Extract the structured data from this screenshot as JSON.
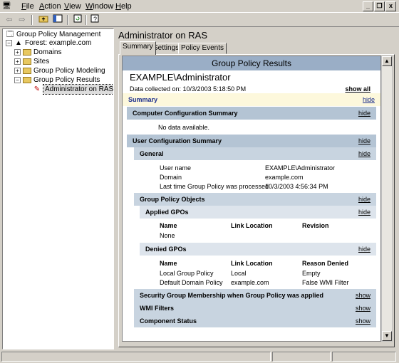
{
  "menu": {
    "file": "File",
    "action": "Action",
    "view": "View",
    "window": "Window",
    "help": "Help"
  },
  "window_controls": {
    "minimize": "_",
    "restore": "❐",
    "close": "x"
  },
  "tree": {
    "root": "Group Policy Management",
    "forest": "Forest: example.com",
    "domains": "Domains",
    "sites": "Sites",
    "modeling": "Group Policy Modeling",
    "results": "Group Policy Results",
    "admin": "Administrator on RAS"
  },
  "pane": {
    "title": "Administrator on RAS",
    "tabs": [
      "Summary",
      "Settings",
      "Policy Events"
    ]
  },
  "report": {
    "header": "Group Policy Results",
    "account": "EXAMPLE\\Administrator",
    "collected": "Data collected on: 10/3/2003 5:18:50 PM",
    "show_all": "show all",
    "hide": "hide",
    "show": "show",
    "summary": "Summary",
    "computer_summary": "Computer Configuration Summary",
    "no_data": "No data available.",
    "user_summary": "User Configuration Summary",
    "general": "General",
    "general_rows": [
      {
        "label": "User name",
        "value": "EXAMPLE\\Administrator"
      },
      {
        "label": "Domain",
        "value": "example.com"
      },
      {
        "label": "Last time Group Policy was processed",
        "value": "10/3/2003 4:56:34 PM"
      }
    ],
    "gpo": "Group Policy Objects",
    "applied": "Applied GPOs",
    "applied_cols": [
      "Name",
      "Link Location",
      "Revision"
    ],
    "applied_none": "None",
    "denied": "Denied GPOs",
    "denied_cols": [
      "Name",
      "Link Location",
      "Reason Denied"
    ],
    "denied_rows": [
      [
        "Local Group Policy",
        "Local",
        "Empty"
      ],
      [
        "Default Domain Policy",
        "example.com",
        "False WMI Filter"
      ]
    ],
    "security": "Security Group Membership when Group Policy was applied",
    "wmi": "WMI Filters",
    "component": "Component Status"
  },
  "colors": {
    "header": "#9aaec6",
    "section": "#b4c4d4",
    "summary_bg": "#fdf8dc"
  }
}
